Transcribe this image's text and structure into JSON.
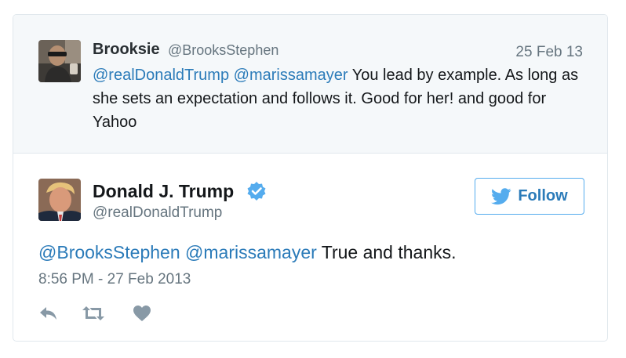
{
  "parent_tweet": {
    "name": "Brooksie",
    "handle": "@BrooksStephen",
    "date": "25 Feb 13",
    "mention_1": "@realDonaldTrump",
    "mention_2": "@marissamayer",
    "text": "You lead by example. As long as she sets an expectation and follows it. Good for her! and good for Yahoo",
    "avatar_icon": "user-photo-avatar"
  },
  "main_tweet": {
    "name": "Donald J. Trump",
    "handle": "@realDonaldTrump",
    "verified_icon": "verified-badge-icon",
    "follow_label": "Follow",
    "mention_1": "@BrooksStephen",
    "mention_2": "@marissamayer",
    "text": "True and thanks.",
    "timestamp": "8:56 PM - 27 Feb 2013",
    "avatar_icon": "user-photo-avatar"
  },
  "actions": {
    "reply_icon": "reply-icon",
    "retweet_icon": "retweet-icon",
    "like_icon": "heart-icon"
  },
  "colors": {
    "link": "#2b7bb9",
    "twitter_blue": "#55acee",
    "muted": "#66757f",
    "parent_bg": "#f5f8fa",
    "icon": "#8899a6"
  }
}
